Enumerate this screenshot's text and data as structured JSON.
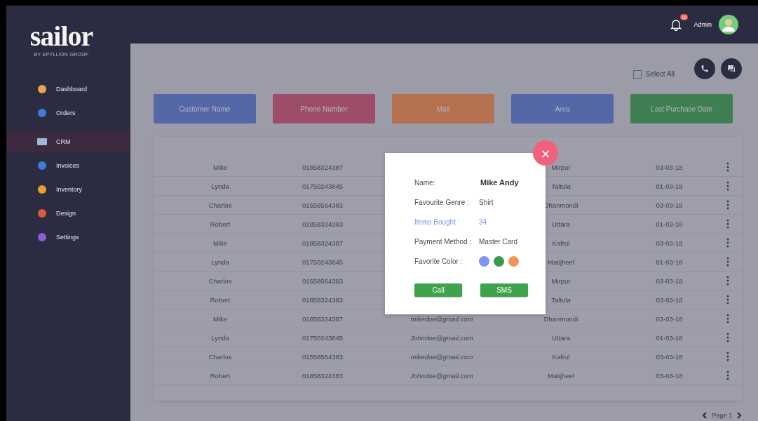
{
  "sidebar": {
    "logo": "sailor",
    "logo_subtitle": "BY EPYLLION GROUP",
    "items": [
      {
        "label": "Dashboard",
        "selected": false
      },
      {
        "label": "Orders",
        "selected": false
      },
      {
        "label": "CRM",
        "selected": true
      },
      {
        "label": "Invoices",
        "selected": false
      },
      {
        "label": "Inventory",
        "selected": false
      },
      {
        "label": "Design",
        "selected": false
      },
      {
        "label": "Settings",
        "selected": false
      }
    ]
  },
  "header": {
    "notification_count": "15",
    "user": "Admin"
  },
  "toolbar": {
    "select_all": {
      "label": "Select All",
      "checked": false
    }
  },
  "filters": [
    {
      "label": "Customer Name",
      "color": "#5468a8"
    },
    {
      "label": "Phone Number",
      "color": "#9e4d69"
    },
    {
      "label": "Mail",
      "color": "#b5704f"
    },
    {
      "label": "Area",
      "color": "#5468a8"
    },
    {
      "label": "Last Purchase Date",
      "color": "#3f7f51"
    }
  ],
  "table": {
    "rows": [
      {
        "name": "Mike",
        "phone": "01858324387",
        "area": "Mirpur",
        "date": "03-03-18"
      },
      {
        "name": "Lynda",
        "phone": "01750243845",
        "area": "Taltola",
        "date": "01-03-18"
      },
      {
        "name": "Charlos",
        "phone": "01558564383",
        "area": "Dhanmondi",
        "date": "03-03-18"
      },
      {
        "name": "Robert",
        "phone": "01858324383",
        "area": "Uttara",
        "date": "01-03-18"
      },
      {
        "name": "Mike",
        "phone": "01858324387",
        "area": "Kafrul",
        "date": "03-03-18"
      },
      {
        "name": "Lynda",
        "phone": "01750243845",
        "area": "Matijheel",
        "date": "01-03-18"
      },
      {
        "name": "Charlos",
        "phone": "01558564383",
        "area": "Mirpur",
        "date": "03-03-18"
      },
      {
        "name": "Robert",
        "phone": "01858324383",
        "area": "Taltola",
        "date": "03-03-18"
      },
      {
        "name": "Mike",
        "phone": "01858324387",
        "mail": "mikedoe@gmail.com",
        "area": "Dhanmondi",
        "date": "03-03-18"
      },
      {
        "name": "Lynda",
        "phone": "01750243845",
        "mail": "Johndoe@gmail.com",
        "area": "Uttara",
        "date": "01-03-18"
      },
      {
        "name": "Charlos",
        "phone": "01558564383",
        "mail": "mikedoe@gmail.com",
        "area": "Kafrul",
        "date": "03-03-18"
      },
      {
        "name": "Robert",
        "phone": "01858324383",
        "mail": "Johndoe@gmail.com",
        "area": "Matijheel",
        "date": "03-03-18"
      }
    ]
  },
  "pagination": {
    "label": "Page 1"
  },
  "popup": {
    "close": "×",
    "fields": [
      {
        "kind": "text",
        "label": "Name:",
        "value": "Mike Andy",
        "highlighted": false
      },
      {
        "kind": "text",
        "label": "Favourite Genre :",
        "value": "Shirt",
        "highlighted": false
      },
      {
        "kind": "text",
        "label": "Items Bought :",
        "value": "34",
        "highlighted": true
      },
      {
        "kind": "text",
        "label": "Payment Method :",
        "value": "Master Card",
        "highlighted": false
      },
      {
        "kind": "colors",
        "label": "Favorite Color :",
        "colors": [
          {
            "color": "#7b96f0"
          },
          {
            "color": "#3a9a4a"
          },
          {
            "color": "#f59452"
          }
        ],
        "highlighted": false
      }
    ],
    "buttons": [
      "Call",
      "SMS"
    ]
  }
}
